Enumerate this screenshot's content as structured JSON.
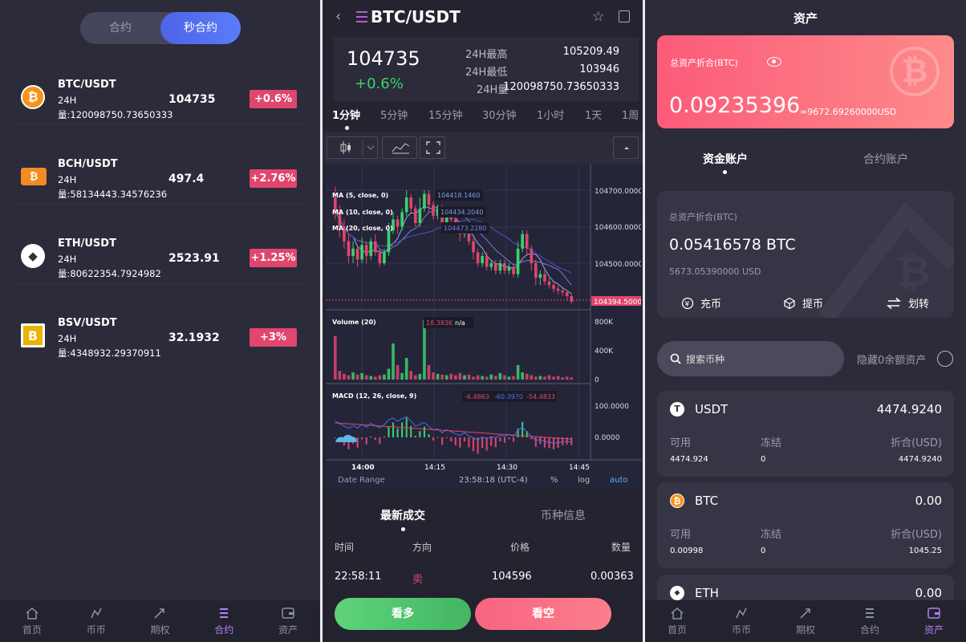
{
  "panel_markets": {
    "segments": [
      "合约",
      "秒合约"
    ],
    "active_segment": "秒合约",
    "rows": [
      {
        "pair": "BTC/USDT",
        "label24": "24H",
        "volume": "量:120098750.73650333",
        "price": "104735",
        "change": "+0.6%",
        "coin": "btc-icon",
        "color": "#f7931a",
        "glyph": "₿"
      },
      {
        "pair": "BCH/USDT",
        "label24": "24H",
        "volume": "量:58134443.34576236",
        "price": "497.4",
        "change": "+2.76%",
        "coin": "bch-icon",
        "color": "#f28b21",
        "glyph": "₿"
      },
      {
        "pair": "ETH/USDT",
        "label24": "24H",
        "volume": "量:80622354.7924982",
        "price": "2523.91",
        "change": "+1.25%",
        "coin": "eth-icon",
        "color": "#ffffff",
        "glyph": "◆"
      },
      {
        "pair": "BSV/USDT",
        "label24": "24H",
        "volume": "量:4348932.29370911",
        "price": "32.1932",
        "change": "+3%",
        "coin": "bsv-icon",
        "color": "#eab300",
        "glyph": "B"
      }
    ]
  },
  "tabbar_left": {
    "items": [
      "首页",
      "币币",
      "期权",
      "合约",
      "资产"
    ],
    "active": "合约"
  },
  "panel_chart": {
    "title": "BTC/USDT",
    "last_price": "104735",
    "change": "+0.6%",
    "stats": [
      {
        "label": "24H最高",
        "value": "105209.49"
      },
      {
        "label": "24H最低",
        "value": "103946"
      },
      {
        "label": "24H量",
        "value": "120098750.73650333"
      }
    ],
    "timeframes": [
      "1分钟",
      "5分钟",
      "15分钟",
      "30分钟",
      "1小时",
      "1天",
      "1周"
    ],
    "active_timeframe": "1分钟",
    "indicators": {
      "ma5": "MA (5, close, 0)",
      "ma10": "MA (10, close, 0)",
      "ma20": "MA (20, close, 0)",
      "ma5_val": "104418.1460",
      "ma10_val": "104434.2040",
      "ma20_val": "104473.2280",
      "volume": "Volume (20)",
      "volume_val": "18.383K",
      "volume_na": "n/a",
      "macd": "MACD (12, 26, close, 9)",
      "macd_v1": "-6.4863",
      "macd_v2": "-60.3970",
      "macd_v3": "-54.4833"
    },
    "price_axis": [
      "104700.0000",
      "104600.0000",
      "104500.0000"
    ],
    "current_price_tag": "104394.5000",
    "volume_axis": [
      "800K",
      "400K",
      "0"
    ],
    "macd_axis": [
      "100.0000",
      "0.0000"
    ],
    "time_axis": [
      "14:00",
      "14:15",
      "14:30",
      "14:45"
    ],
    "footer": {
      "range": "Date Range",
      "time": "23:58:18 (UTC-4)",
      "pct": "%",
      "log": "log",
      "auto": "auto"
    },
    "bottom_tabs": [
      "最新成交",
      "币种信息"
    ],
    "active_bottom_tab": "最新成交",
    "trade_headers": [
      "时间",
      "方向",
      "价格",
      "数量"
    ],
    "trades": [
      {
        "time": "22:58:11",
        "side": "卖",
        "price": "104596",
        "qty": "0.00363"
      }
    ],
    "buy": "看多",
    "sell": "看空"
  },
  "chart_data": {
    "type": "candlestick",
    "price_axis": [
      104500,
      104600,
      104700
    ],
    "last_price": 104394.5,
    "candles": [
      {
        "o": 104680,
        "c": 104640,
        "h": 104710,
        "l": 104620
      },
      {
        "o": 104640,
        "c": 104600,
        "h": 104660,
        "l": 104570
      },
      {
        "o": 104600,
        "c": 104560,
        "h": 104620,
        "l": 104540
      },
      {
        "o": 104560,
        "c": 104520,
        "h": 104580,
        "l": 104500
      },
      {
        "o": 104520,
        "c": 104540,
        "h": 104560,
        "l": 104500
      },
      {
        "o": 104540,
        "c": 104510,
        "h": 104550,
        "l": 104490
      },
      {
        "o": 104510,
        "c": 104550,
        "h": 104570,
        "l": 104500
      },
      {
        "o": 104550,
        "c": 104520,
        "h": 104560,
        "l": 104500
      },
      {
        "o": 104520,
        "c": 104560,
        "h": 104570,
        "l": 104510
      },
      {
        "o": 104560,
        "c": 104530,
        "h": 104580,
        "l": 104520
      },
      {
        "o": 104530,
        "c": 104500,
        "h": 104540,
        "l": 104490
      },
      {
        "o": 104500,
        "c": 104530,
        "h": 104540,
        "l": 104495
      },
      {
        "o": 104530,
        "c": 104590,
        "h": 104610,
        "l": 104520
      },
      {
        "o": 104590,
        "c": 104620,
        "h": 104640,
        "l": 104580
      },
      {
        "o": 104620,
        "c": 104600,
        "h": 104630,
        "l": 104580
      },
      {
        "o": 104600,
        "c": 104640,
        "h": 104650,
        "l": 104590
      },
      {
        "o": 104640,
        "c": 104680,
        "h": 104700,
        "l": 104630
      },
      {
        "o": 104680,
        "c": 104650,
        "h": 104690,
        "l": 104640
      },
      {
        "o": 104650,
        "c": 104610,
        "h": 104660,
        "l": 104600
      },
      {
        "o": 104610,
        "c": 104650,
        "h": 104680,
        "l": 104600
      },
      {
        "o": 104650,
        "c": 104690,
        "h": 104700,
        "l": 104640
      },
      {
        "o": 104690,
        "c": 104660,
        "h": 104700,
        "l": 104640
      },
      {
        "o": 104660,
        "c": 104630,
        "h": 104670,
        "l": 104620
      },
      {
        "o": 104630,
        "c": 104650,
        "h": 104660,
        "l": 104620
      },
      {
        "o": 104650,
        "c": 104610,
        "h": 104660,
        "l": 104600
      },
      {
        "o": 104610,
        "c": 104640,
        "h": 104650,
        "l": 104600
      },
      {
        "o": 104640,
        "c": 104620,
        "h": 104650,
        "l": 104610
      },
      {
        "o": 104620,
        "c": 104600,
        "h": 104630,
        "l": 104590
      },
      {
        "o": 104600,
        "c": 104580,
        "h": 104610,
        "l": 104560
      },
      {
        "o": 104580,
        "c": 104600,
        "h": 104610,
        "l": 104570
      },
      {
        "o": 104600,
        "c": 104560,
        "h": 104610,
        "l": 104550
      },
      {
        "o": 104560,
        "c": 104530,
        "h": 104570,
        "l": 104510
      },
      {
        "o": 104530,
        "c": 104500,
        "h": 104540,
        "l": 104490
      },
      {
        "o": 104500,
        "c": 104520,
        "h": 104530,
        "l": 104490
      },
      {
        "o": 104520,
        "c": 104490,
        "h": 104530,
        "l": 104480
      },
      {
        "o": 104490,
        "c": 104500,
        "h": 104510,
        "l": 104480
      },
      {
        "o": 104500,
        "c": 104480,
        "h": 104510,
        "l": 104470
      },
      {
        "o": 104480,
        "c": 104500,
        "h": 104510,
        "l": 104470
      },
      {
        "o": 104500,
        "c": 104480,
        "h": 104510,
        "l": 104470
      },
      {
        "o": 104480,
        "c": 104490,
        "h": 104500,
        "l": 104470
      },
      {
        "o": 104490,
        "c": 104470,
        "h": 104500,
        "l": 104460
      },
      {
        "o": 104470,
        "c": 104540,
        "h": 104560,
        "l": 104460
      },
      {
        "o": 104540,
        "c": 104580,
        "h": 104590,
        "l": 104530
      },
      {
        "o": 104580,
        "c": 104540,
        "h": 104590,
        "l": 104520
      },
      {
        "o": 104540,
        "c": 104500,
        "h": 104550,
        "l": 104480
      },
      {
        "o": 104500,
        "c": 104460,
        "h": 104510,
        "l": 104440
      },
      {
        "o": 104460,
        "c": 104470,
        "h": 104480,
        "l": 104440
      },
      {
        "o": 104470,
        "c": 104450,
        "h": 104480,
        "l": 104440
      },
      {
        "o": 104450,
        "c": 104440,
        "h": 104460,
        "l": 104430
      },
      {
        "o": 104440,
        "c": 104430,
        "h": 104450,
        "l": 104420
      },
      {
        "o": 104430,
        "c": 104425,
        "h": 104440,
        "l": 104415
      },
      {
        "o": 104425,
        "c": 104420,
        "h": 104435,
        "l": 104410
      },
      {
        "o": 104420,
        "c": 104410,
        "h": 104425,
        "l": 104400
      },
      {
        "o": 104410,
        "c": 104395,
        "h": 104415,
        "l": 104390
      }
    ],
    "volume_axis": [
      0,
      400000,
      800000
    ],
    "volumes": [
      600000,
      120000,
      80000,
      60000,
      100000,
      70000,
      90000,
      60000,
      50000,
      40000,
      60000,
      70000,
      150000,
      500000,
      200000,
      90000,
      300000,
      120000,
      60000,
      80000,
      820000,
      200000,
      100000,
      80000,
      70000,
      60000,
      80000,
      60000,
      90000,
      60000,
      70000,
      40000,
      60000,
      50000,
      40000,
      70000,
      50000,
      90000,
      60000,
      40000,
      50000,
      200000,
      100000,
      80000,
      60000,
      40000,
      50000,
      40000,
      60000,
      40000,
      50000,
      30000,
      40000,
      30000
    ],
    "macd_axis": [
      0,
      100
    ],
    "time_axis": [
      "14:00",
      "14:15",
      "14:30",
      "14:45"
    ]
  },
  "panel_assets": {
    "title": "资产",
    "card": {
      "label": "总资产折合(BTC)",
      "value": "0.09235396",
      "usd": "≈9672.69260000USD"
    },
    "account_tabs": [
      "资金账户",
      "合约账户"
    ],
    "active_account": "资金账户",
    "wallet": {
      "label": "总资产折合(BTC)",
      "value": "0.05416578 BTC",
      "usd": "5673.05390000 USD",
      "actions": [
        "充币",
        "提币",
        "划转"
      ]
    },
    "search_placeholder": "搜索币种",
    "hide_zero": "隐藏0余额资产",
    "col_labels": [
      "可用",
      "冻结",
      "折合(USD)"
    ],
    "assets": [
      {
        "name": "USDT",
        "total": "4474.9240",
        "available": "4474.924",
        "frozen": "0",
        "usd": "4474.9240",
        "color": "#ffffff",
        "glyph": "T"
      },
      {
        "name": "BTC",
        "total": "0.00",
        "available": "0.00998",
        "frozen": "0",
        "usd": "1045.25",
        "color": "#f7931a",
        "glyph": "₿"
      },
      {
        "name": "ETH",
        "total": "0.00",
        "available": "",
        "frozen": "",
        "usd": "",
        "color": "#ffffff",
        "glyph": "◆"
      }
    ]
  },
  "tabbar_right": {
    "items": [
      "首页",
      "币币",
      "期权",
      "合约",
      "资产"
    ],
    "active": "资产"
  },
  "colors": {
    "up": "#3ad36a",
    "down": "#e0466e",
    "accent": "#b87cf0",
    "bg": "#2b2b3a"
  }
}
